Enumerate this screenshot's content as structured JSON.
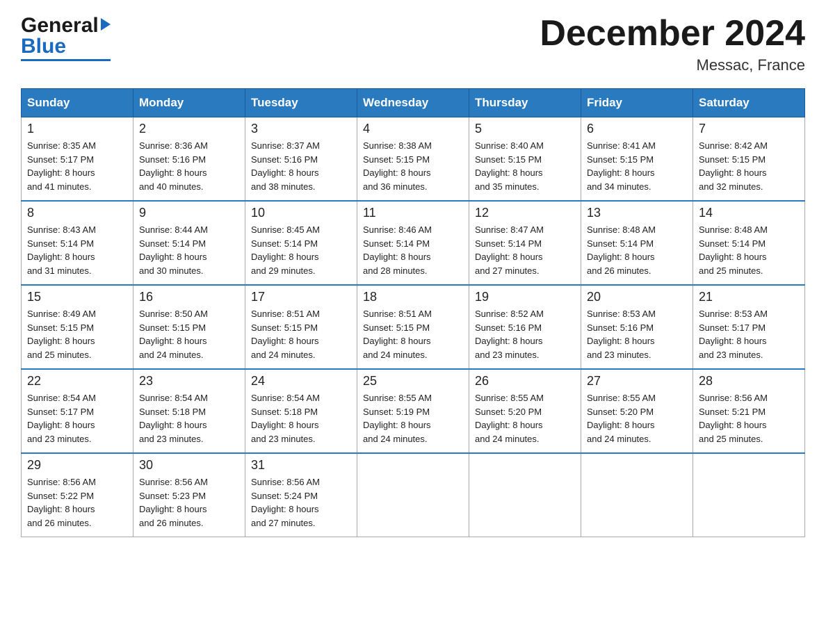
{
  "header": {
    "logo": {
      "general": "General",
      "blue": "Blue",
      "triangle_char": "▶"
    },
    "title": "December 2024",
    "location": "Messac, France"
  },
  "weekdays": [
    "Sunday",
    "Monday",
    "Tuesday",
    "Wednesday",
    "Thursday",
    "Friday",
    "Saturday"
  ],
  "weeks": [
    [
      {
        "day": "1",
        "sunrise": "8:35 AM",
        "sunset": "5:17 PM",
        "daylight": "8 hours and 41 minutes."
      },
      {
        "day": "2",
        "sunrise": "8:36 AM",
        "sunset": "5:16 PM",
        "daylight": "8 hours and 40 minutes."
      },
      {
        "day": "3",
        "sunrise": "8:37 AM",
        "sunset": "5:16 PM",
        "daylight": "8 hours and 38 minutes."
      },
      {
        "day": "4",
        "sunrise": "8:38 AM",
        "sunset": "5:15 PM",
        "daylight": "8 hours and 36 minutes."
      },
      {
        "day": "5",
        "sunrise": "8:40 AM",
        "sunset": "5:15 PM",
        "daylight": "8 hours and 35 minutes."
      },
      {
        "day": "6",
        "sunrise": "8:41 AM",
        "sunset": "5:15 PM",
        "daylight": "8 hours and 34 minutes."
      },
      {
        "day": "7",
        "sunrise": "8:42 AM",
        "sunset": "5:15 PM",
        "daylight": "8 hours and 32 minutes."
      }
    ],
    [
      {
        "day": "8",
        "sunrise": "8:43 AM",
        "sunset": "5:14 PM",
        "daylight": "8 hours and 31 minutes."
      },
      {
        "day": "9",
        "sunrise": "8:44 AM",
        "sunset": "5:14 PM",
        "daylight": "8 hours and 30 minutes."
      },
      {
        "day": "10",
        "sunrise": "8:45 AM",
        "sunset": "5:14 PM",
        "daylight": "8 hours and 29 minutes."
      },
      {
        "day": "11",
        "sunrise": "8:46 AM",
        "sunset": "5:14 PM",
        "daylight": "8 hours and 28 minutes."
      },
      {
        "day": "12",
        "sunrise": "8:47 AM",
        "sunset": "5:14 PM",
        "daylight": "8 hours and 27 minutes."
      },
      {
        "day": "13",
        "sunrise": "8:48 AM",
        "sunset": "5:14 PM",
        "daylight": "8 hours and 26 minutes."
      },
      {
        "day": "14",
        "sunrise": "8:48 AM",
        "sunset": "5:14 PM",
        "daylight": "8 hours and 25 minutes."
      }
    ],
    [
      {
        "day": "15",
        "sunrise": "8:49 AM",
        "sunset": "5:15 PM",
        "daylight": "8 hours and 25 minutes."
      },
      {
        "day": "16",
        "sunrise": "8:50 AM",
        "sunset": "5:15 PM",
        "daylight": "8 hours and 24 minutes."
      },
      {
        "day": "17",
        "sunrise": "8:51 AM",
        "sunset": "5:15 PM",
        "daylight": "8 hours and 24 minutes."
      },
      {
        "day": "18",
        "sunrise": "8:51 AM",
        "sunset": "5:15 PM",
        "daylight": "8 hours and 24 minutes."
      },
      {
        "day": "19",
        "sunrise": "8:52 AM",
        "sunset": "5:16 PM",
        "daylight": "8 hours and 23 minutes."
      },
      {
        "day": "20",
        "sunrise": "8:53 AM",
        "sunset": "5:16 PM",
        "daylight": "8 hours and 23 minutes."
      },
      {
        "day": "21",
        "sunrise": "8:53 AM",
        "sunset": "5:17 PM",
        "daylight": "8 hours and 23 minutes."
      }
    ],
    [
      {
        "day": "22",
        "sunrise": "8:54 AM",
        "sunset": "5:17 PM",
        "daylight": "8 hours and 23 minutes."
      },
      {
        "day": "23",
        "sunrise": "8:54 AM",
        "sunset": "5:18 PM",
        "daylight": "8 hours and 23 minutes."
      },
      {
        "day": "24",
        "sunrise": "8:54 AM",
        "sunset": "5:18 PM",
        "daylight": "8 hours and 23 minutes."
      },
      {
        "day": "25",
        "sunrise": "8:55 AM",
        "sunset": "5:19 PM",
        "daylight": "8 hours and 24 minutes."
      },
      {
        "day": "26",
        "sunrise": "8:55 AM",
        "sunset": "5:20 PM",
        "daylight": "8 hours and 24 minutes."
      },
      {
        "day": "27",
        "sunrise": "8:55 AM",
        "sunset": "5:20 PM",
        "daylight": "8 hours and 24 minutes."
      },
      {
        "day": "28",
        "sunrise": "8:56 AM",
        "sunset": "5:21 PM",
        "daylight": "8 hours and 25 minutes."
      }
    ],
    [
      {
        "day": "29",
        "sunrise": "8:56 AM",
        "sunset": "5:22 PM",
        "daylight": "8 hours and 26 minutes."
      },
      {
        "day": "30",
        "sunrise": "8:56 AM",
        "sunset": "5:23 PM",
        "daylight": "8 hours and 26 minutes."
      },
      {
        "day": "31",
        "sunrise": "8:56 AM",
        "sunset": "5:24 PM",
        "daylight": "8 hours and 27 minutes."
      },
      null,
      null,
      null,
      null
    ]
  ],
  "labels": {
    "sunrise": "Sunrise:",
    "sunset": "Sunset:",
    "daylight": "Daylight:"
  }
}
